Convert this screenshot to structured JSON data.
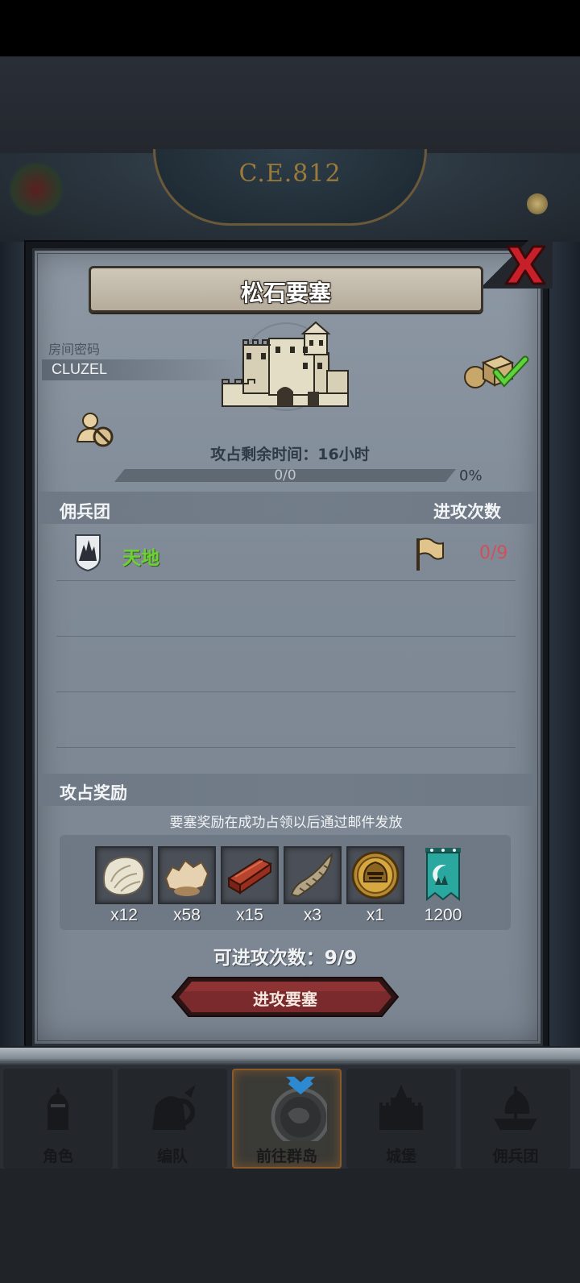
{
  "header": {
    "era": "C.E.812"
  },
  "dialog": {
    "title": "松石要塞",
    "room_label": "房间密码",
    "room_code": "CLUZEL",
    "time_label": "攻占剩余时间：16小时",
    "progress": {
      "text": "0/0",
      "percent_text": "0%",
      "fraction": 0
    },
    "mercenary_section": {
      "title": "佣兵团",
      "attacks_title": "进攻次数"
    },
    "mercenaries": [
      {
        "name": "天地",
        "attacks": "0/9"
      }
    ],
    "rewards_section": {
      "title": "攻占奖励",
      "note": "要塞奖励在成功占领以后通过邮件发放",
      "items": [
        {
          "icon": "fur-pelt-icon",
          "qty": "x12"
        },
        {
          "icon": "leather-hide-icon",
          "qty": "x58"
        },
        {
          "icon": "wood-planks-icon",
          "qty": "x15"
        },
        {
          "icon": "horn-icon",
          "qty": "x3"
        },
        {
          "icon": "knight-helmet-coin-icon",
          "qty": "x1"
        },
        {
          "icon": "mercenary-banner-icon",
          "qty": "1200"
        }
      ]
    },
    "available_attacks": "可进攻次数：9/9",
    "attack_button": "进攻要塞"
  },
  "nav": {
    "items": [
      {
        "label": "角色",
        "icon": "knight-icon"
      },
      {
        "label": "编队",
        "icon": "team-icon"
      },
      {
        "label": "前往群岛",
        "icon": "islands-icon",
        "active": true
      },
      {
        "label": "城堡",
        "icon": "castle-icon"
      },
      {
        "label": "佣兵团",
        "icon": "mercenary-ship-icon"
      }
    ]
  },
  "colors": {
    "panel": "#8d98a4",
    "mercenary_name": "#6cd234",
    "attack_count": "#d0505a",
    "attack_button": "#7a2a2c",
    "close_x": "#c8202a"
  }
}
